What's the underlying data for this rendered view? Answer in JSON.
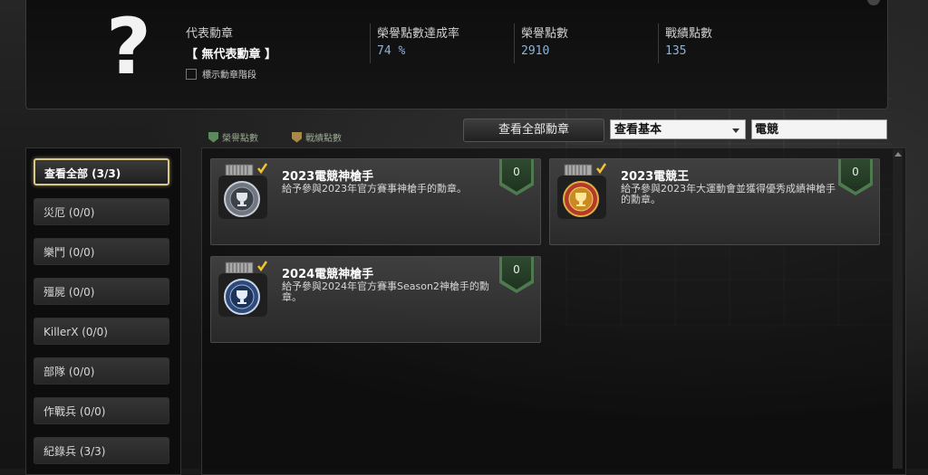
{
  "header": {
    "rep_medal_label": "代表勳章",
    "rep_medal_value": "【 無代表勳章 】",
    "show_tier_label": "標示勳章階段",
    "honor_rate_label": "榮譽點數達成率",
    "honor_rate_value": "74 %",
    "honor_points_label": "榮譽點數",
    "honor_points_value": "2910",
    "record_points_label": "戰績點數",
    "record_points_value": "135"
  },
  "toolbar": {
    "legend_honor": "榮譽點數",
    "legend_record": "戰績點數",
    "view_all_label": "查看全部勳章",
    "filter_value": "查看基本",
    "search_value": "電競"
  },
  "sidebar": {
    "items": [
      {
        "label": "查看全部 (3/3)"
      },
      {
        "label": "災厄 (0/0)"
      },
      {
        "label": "樂鬥 (0/0)"
      },
      {
        "label": "殭屍 (0/0)"
      },
      {
        "label": "KillerX (0/0)"
      },
      {
        "label": "部隊 (0/0)"
      },
      {
        "label": "作戰兵 (0/0)"
      },
      {
        "label": "紀錄兵 (3/3)"
      }
    ]
  },
  "medals": [
    {
      "title": "2023電競神槍手",
      "desc": "給予參與2023年官方賽事神槍手的勳章。",
      "points": "0"
    },
    {
      "title": "2023電競王",
      "desc": "給予參與2023年大運動會並獲得優秀成績神槍手的勳章。",
      "points": "0"
    },
    {
      "title": " 2024電競神槍手",
      "desc": "給予參與2024年官方賽事Season2神槍手的勳章。",
      "points": "0"
    }
  ],
  "colors": {
    "accent_gold": "#d8c88a",
    "badge_green": "#4f7a4f",
    "value_blue": "#8fb3d6"
  }
}
